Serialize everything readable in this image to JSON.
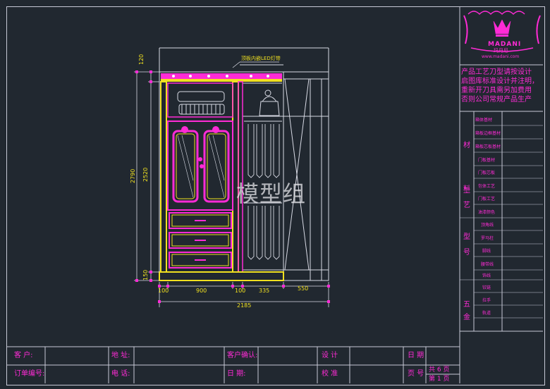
{
  "drawing": {
    "led_label": "顶板内嵌LED灯带",
    "watermark": "模型组",
    "dims_bottom": [
      "100",
      "900",
      "100",
      "335",
      "550"
    ],
    "dim_total": "2185",
    "dims_left": [
      "120",
      "2520",
      "150"
    ],
    "dim_height": "2790"
  },
  "brand": {
    "name": "MADANI",
    "cn": "玛丹尼",
    "url": "www.madani.com"
  },
  "notice": [
    "产品工艺刀型请按设计",
    "启图库标准设计并注明，",
    "重新开刀具需另加费用",
    "否则公司常规产品生产"
  ],
  "spec": {
    "group_material": "材料",
    "group_craft": "工艺",
    "group_model": "型号",
    "group_hardware": "五金",
    "rows": [
      "箱体基材",
      "箱板边框基材",
      "箱板芯板基材",
      "门板基材",
      "门板芯板",
      "包体工艺",
      "门板工艺",
      "油漆颜色",
      "顶角线",
      "罗马柱",
      "脚线",
      "腰带线",
      "饰线",
      "铰链",
      "拉手",
      "轨道"
    ]
  },
  "titleblock": {
    "customer": "客    户:",
    "order_no": "订单编号:",
    "address": "地  址:",
    "phone": "电  话:",
    "confirm": "客户确认:",
    "date": "日    期:",
    "design": "设  计",
    "check": "校  准",
    "date2": "日  期",
    "pages": "页  号",
    "total": "共 6  页",
    "current": "第  1  页"
  },
  "colors": {
    "accent": "#ff2bd6",
    "line": "#c7c9d6",
    "yellow": "#f0e020",
    "bg": "#212830"
  }
}
